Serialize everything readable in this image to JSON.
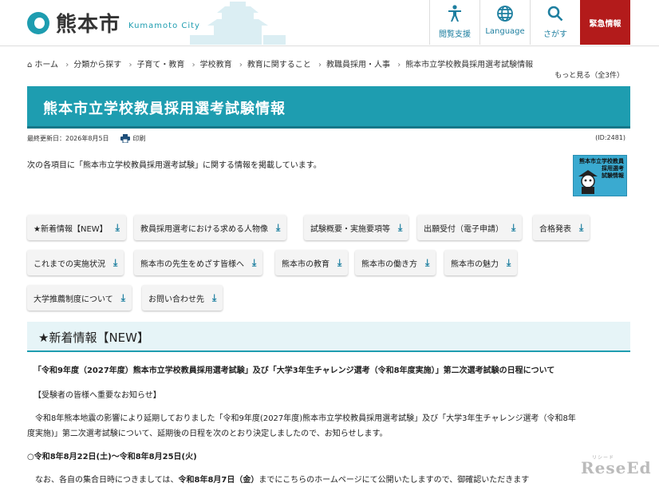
{
  "header": {
    "logo_text": "熊本市",
    "logo_sub": "Kumamoto City",
    "nav": [
      {
        "label": "閲覧支援",
        "icon": "accessibility-icon"
      },
      {
        "label": "Language",
        "icon": "globe-icon"
      },
      {
        "label": "さがす",
        "icon": "search-icon"
      }
    ],
    "emergency": "緊急情報"
  },
  "breadcrumb": [
    "ホーム",
    "分類から探す",
    "子育て・教育",
    "学校教育",
    "教育に関すること",
    "教職員採用・人事",
    "熊本市立学校教員採用選考試験情報"
  ],
  "more_link": "もっと見る（全3件）",
  "page_title": "熊本市立学校教員採用選考試験情報",
  "meta": {
    "updated": "最終更新日：2026年8月5日",
    "print": "印刷",
    "id": "(ID:2481)"
  },
  "intro": "次の各項目に「熊本市立学校教員採用選考試験」に関する情報を掲載しています。",
  "badge_text": "熊本市立学校教員\n採用選考\n試験情報",
  "tags": [
    "★新着情報【NEW】",
    "教員採用選考における求める人物像",
    "試験概要・実施要項等",
    "出願受付（電子申請）",
    "合格発表",
    "これまでの実施状況",
    "熊本市の先生をめざす皆様へ",
    "熊本市の教育",
    "熊本市の働き方",
    "熊本市の魅力",
    "大学推薦制度について",
    "お問い合わせ先"
  ],
  "section": {
    "heading": "★新着情報【NEW】",
    "news_title": "「令和9年度（2027年度）熊本市立学校教員採用選考試験」及び「大学3年生チャレンジ選考（令和8年度実施）」第二次選考試験の日程について",
    "notice": "【受験者の皆様へ重要なお知らせ】",
    "body1": "令和8年熊本地震の影響により延期しておりました「令和9年度(2027年度)熊本市立学校教員採用選考試験」及び「大学3年生チャレンジ選考（令和8年",
    "body2": "度実施)」第二次選考試験について、延期後の日程を次のとおり決定しましたので、お知らせします。",
    "date_line": "○令和8年8月22日(土)〜令和8年8月25日(火)",
    "last_a": "なお、各自の集合日時につきましては、",
    "last_b": "令和8年8月7日（金）",
    "last_c": "までにこちらのホームページにて公開いたしますので、御確認いただきます"
  },
  "watermark": {
    "main": "ReseEd",
    "sub": "リシード"
  },
  "colors": {
    "accent": "#1e9db0",
    "emergency": "#b31b1b"
  }
}
